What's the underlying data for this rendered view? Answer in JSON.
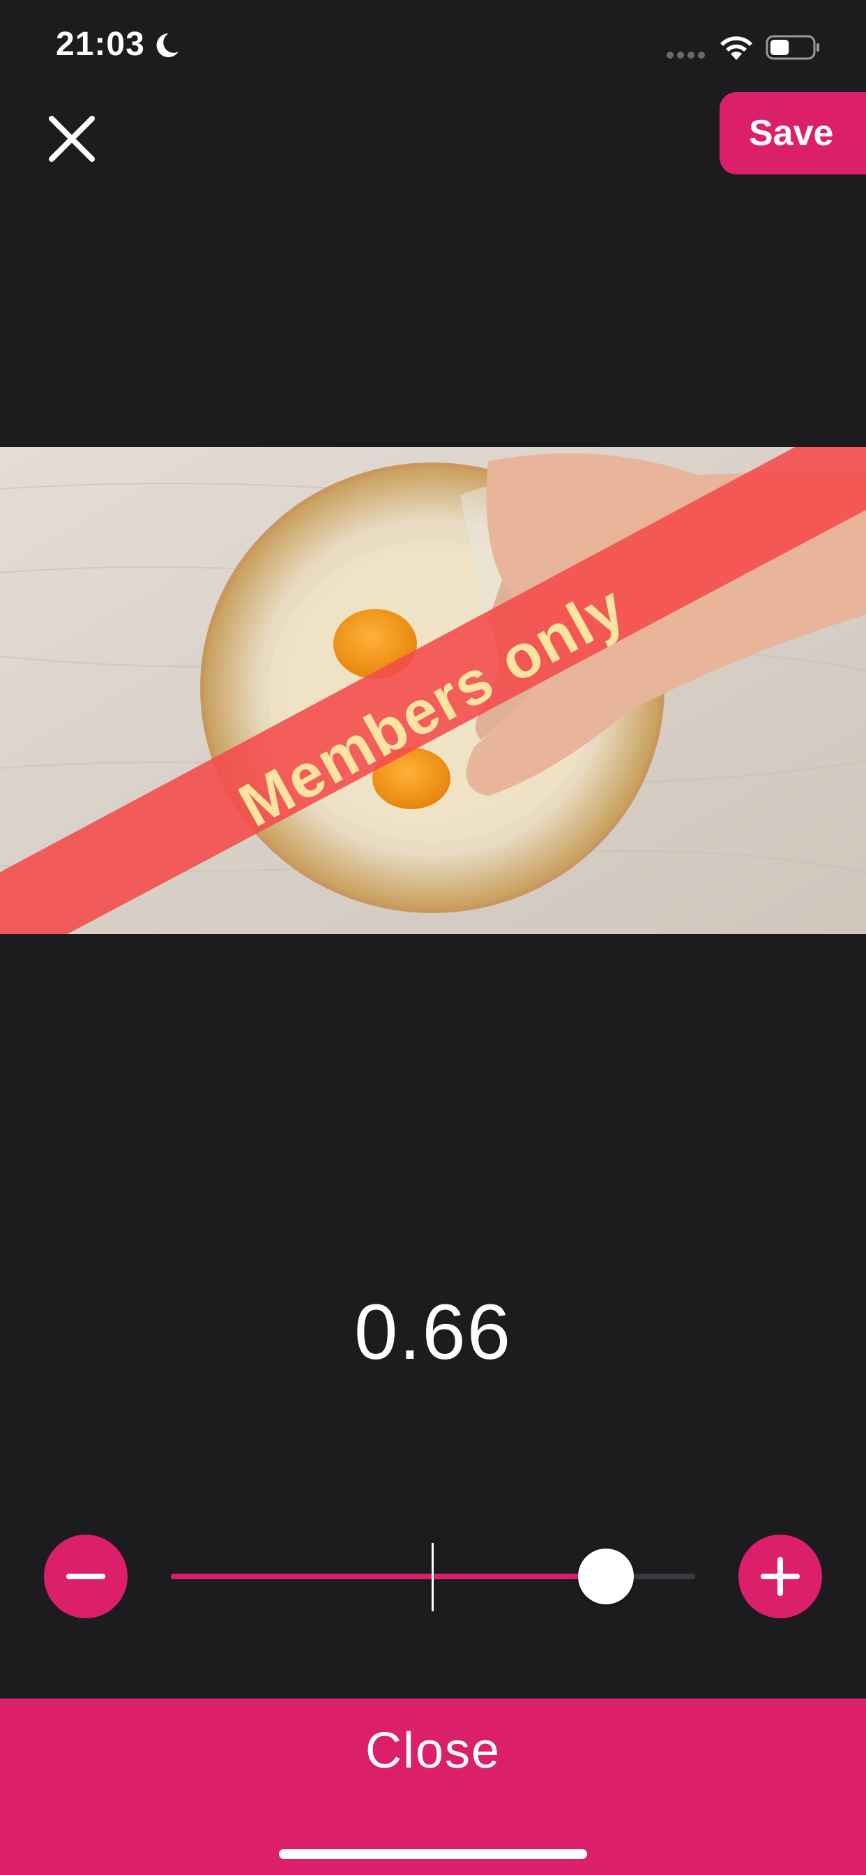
{
  "status_bar": {
    "time": "21:03",
    "icons": [
      "moon-icon",
      "cellular-signal-icon",
      "wifi-icon",
      "battery-icon"
    ],
    "battery_level": 0.4
  },
  "toolbar": {
    "close_icon": "close-icon",
    "save_label": "Save"
  },
  "video": {
    "banner_text": "Members only",
    "banner_color": "#f44b4b",
    "banner_text_color": "#ffe4a1"
  },
  "adjustment": {
    "value_text": "0.66",
    "value": 0.66,
    "fraction": 0.83,
    "minus_icon": "minus-icon",
    "plus_icon": "plus-icon"
  },
  "footer": {
    "close_label": "Close"
  },
  "colors": {
    "accent": "#dc1f6a",
    "background": "#1c1c1e",
    "track": "#3a3a3e"
  }
}
